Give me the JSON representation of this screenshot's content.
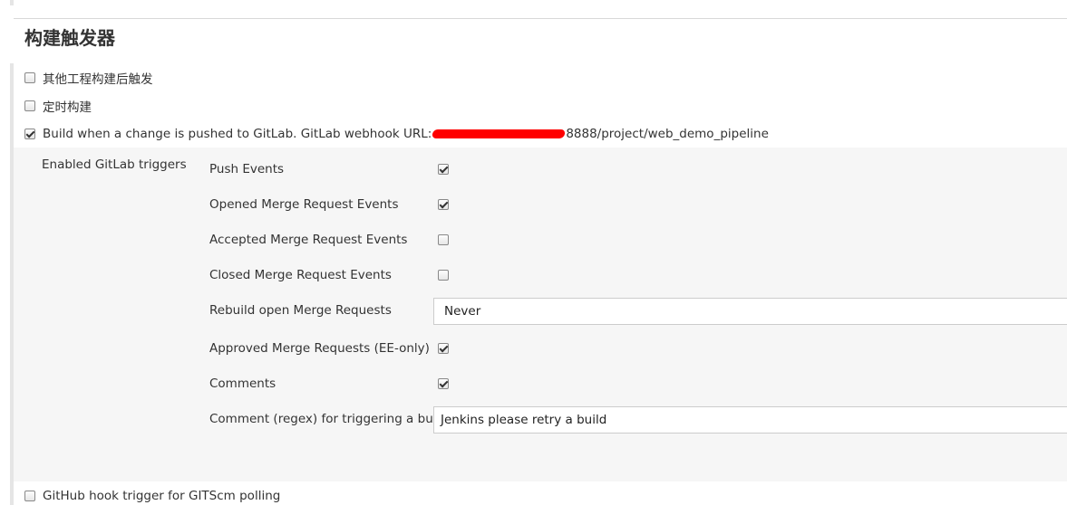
{
  "section": {
    "title": "构建触发器"
  },
  "triggers": {
    "other_project": {
      "label": "其他工程构建后触发",
      "checked": false
    },
    "periodic": {
      "label": "定时构建",
      "checked": false
    },
    "gitlab": {
      "label": "Build when a change is pushed to GitLab. GitLab webhook URL:",
      "url_suffix": "8888/project/web_demo_pipeline",
      "checked": true
    },
    "github": {
      "label": "GitHub hook trigger for GITScm polling",
      "checked": false
    }
  },
  "gitlab_options": {
    "group_label": "Enabled GitLab triggers",
    "push_events": {
      "label": "Push Events",
      "checked": true
    },
    "opened_mr": {
      "label": "Opened Merge Request Events",
      "checked": true
    },
    "accepted_mr": {
      "label": "Accepted Merge Request Events",
      "checked": false
    },
    "closed_mr": {
      "label": "Closed Merge Request Events",
      "checked": false
    },
    "rebuild_open_mr": {
      "label": "Rebuild open Merge Requests",
      "value": "Never"
    },
    "approved_mr": {
      "label": "Approved Merge Requests (EE-only)",
      "checked": true
    },
    "comments": {
      "label": "Comments",
      "checked": true
    },
    "comment_regex": {
      "label": "Comment (regex) for triggering a build",
      "value": "Jenkins please retry a build"
    }
  }
}
